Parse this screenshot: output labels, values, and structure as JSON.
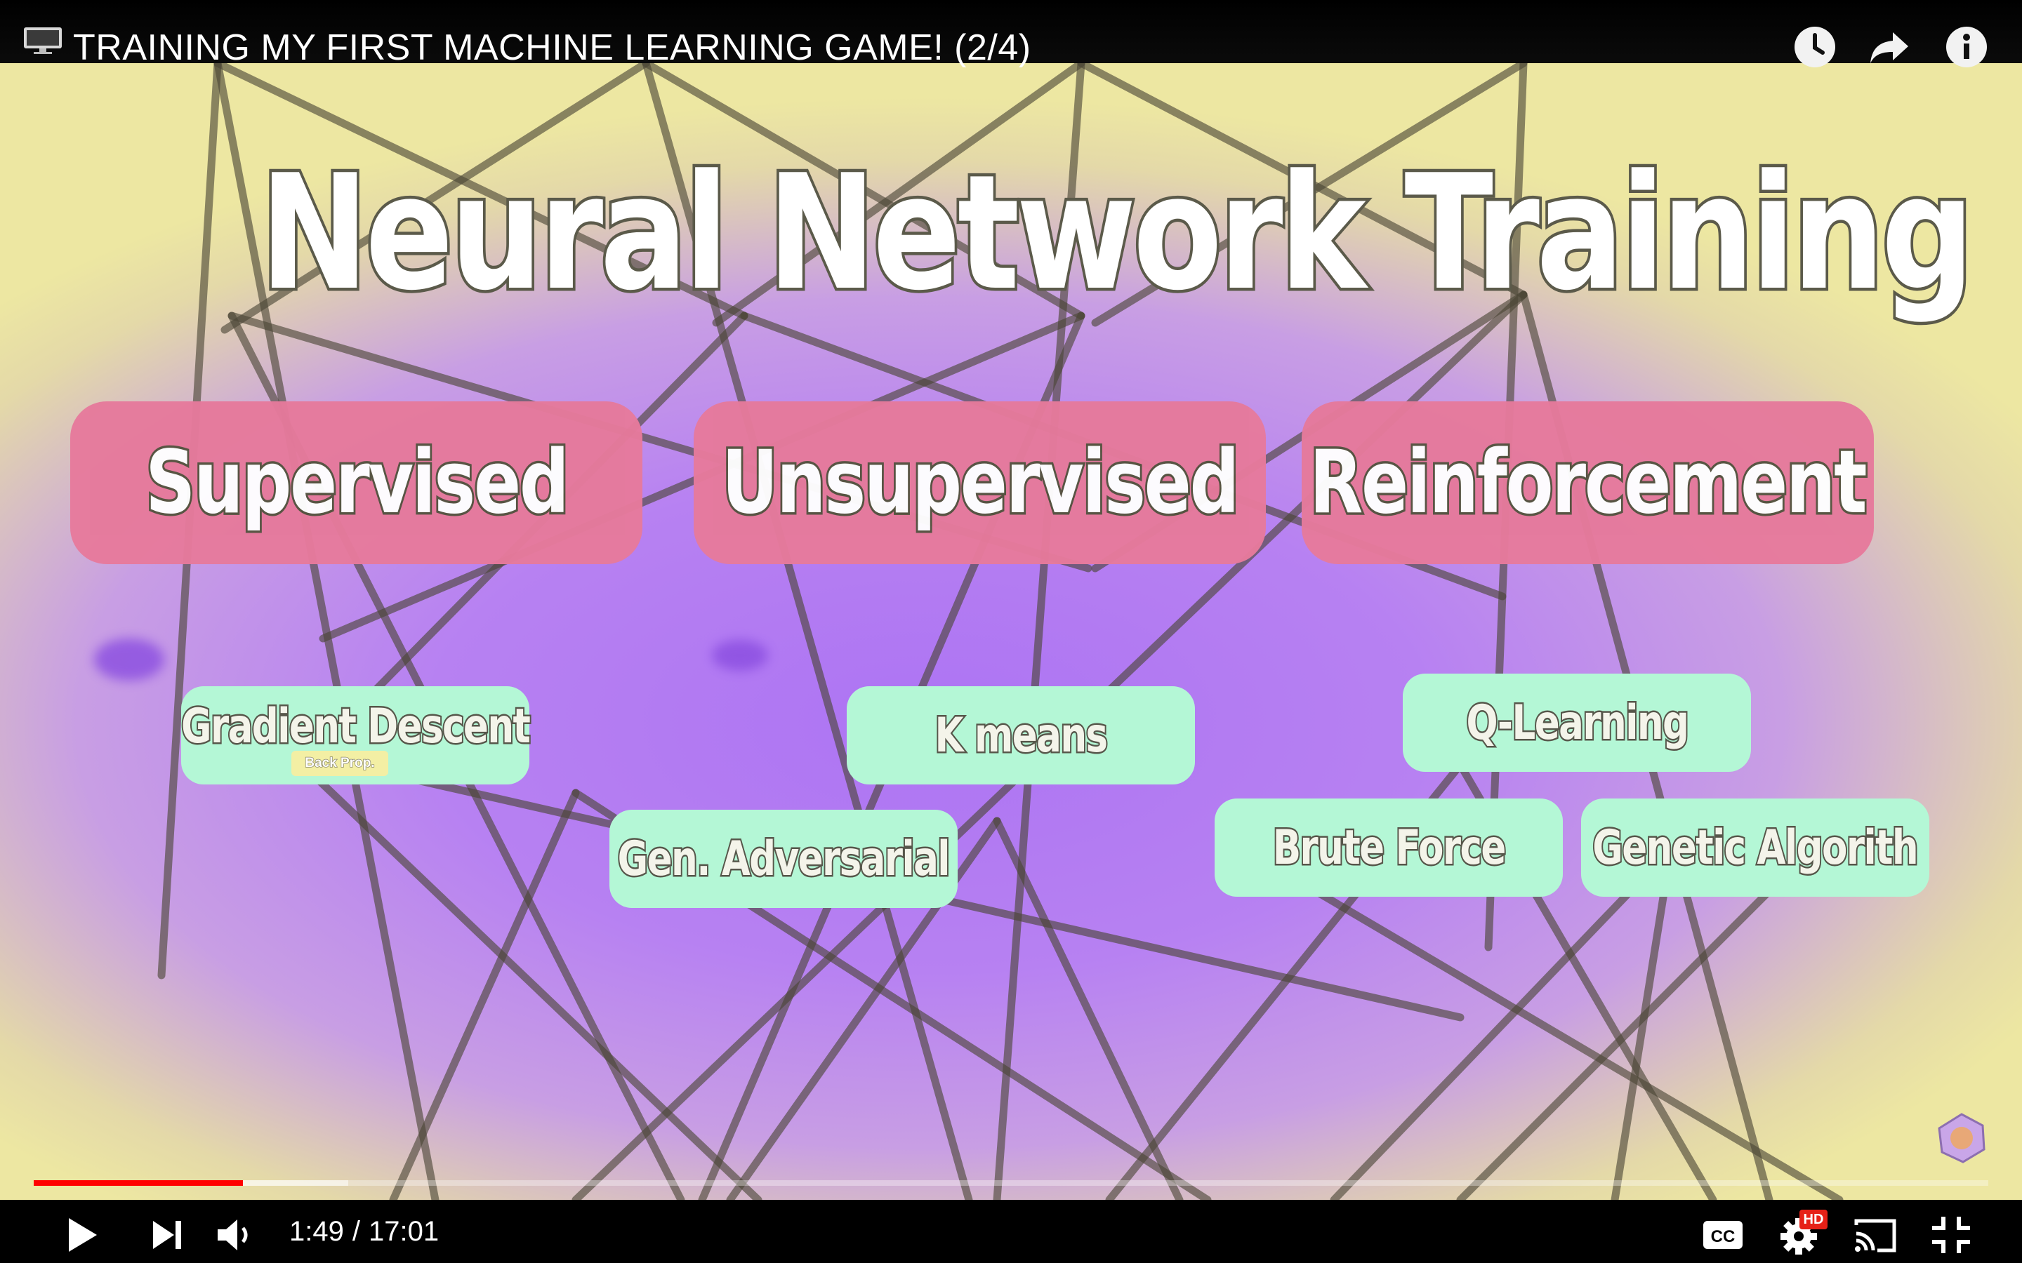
{
  "header": {
    "video_title": "TRAINING MY FIRST MACHINE LEARNING GAME! (2/4)",
    "buttons": [
      "watch-later-icon",
      "share-icon",
      "info-icon"
    ]
  },
  "slide": {
    "heading": "Neural Network Training",
    "categories": [
      {
        "label": "Supervised"
      },
      {
        "label": "Unsupervised"
      },
      {
        "label": "Reinforcement"
      }
    ],
    "algorithms": [
      {
        "label": "Gradient Descent",
        "tag": "Back Prop."
      },
      {
        "label": "K means"
      },
      {
        "label": "Q-Learning"
      },
      {
        "label": "Gen. Adversarial"
      },
      {
        "label": "Brute Force"
      },
      {
        "label": "Genetic Algorith"
      }
    ],
    "colors": {
      "category_box": "#e67a9c",
      "algorithm_box": "#b4f7d6",
      "background_center": "#ad74f3",
      "background_edge": "#ede7a2"
    }
  },
  "player": {
    "current_time": "1:49",
    "separator": "/",
    "duration": "17:01",
    "played_fraction": 0.107,
    "buffered_fraction": 0.161,
    "hd_badge": "HD",
    "progress_color": "#ff0000"
  }
}
